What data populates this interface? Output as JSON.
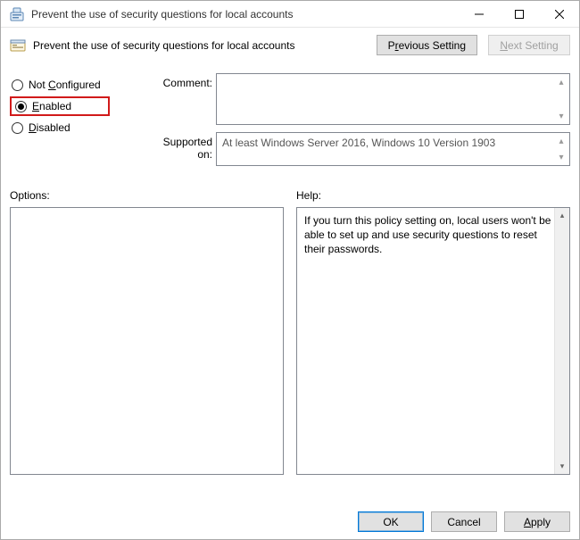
{
  "window": {
    "title": "Prevent the use of security questions for local accounts"
  },
  "header": {
    "policy_title": "Prevent the use of security questions for local accounts",
    "prev_pre": "P",
    "prev_ul": "r",
    "prev_post": "evious Setting",
    "next_ul": "N",
    "next_post": "ext Setting"
  },
  "state": {
    "not_configured_pre": "Not ",
    "not_configured_ul": "C",
    "not_configured_post": "onfigured",
    "enabled_ul": "E",
    "enabled_post": "nabled",
    "disabled_ul": "D",
    "disabled_post": "isabled",
    "selected": "enabled"
  },
  "labels": {
    "comment_pre": "Co",
    "comment_ul": "m",
    "comment_post": "ment:",
    "supported": "Supported on:",
    "options": "Options:",
    "help": "Help:"
  },
  "comment": "",
  "supported_on": "At least Windows Server 2016, Windows 10 Version 1903",
  "help_text": "If you turn this policy setting on, local users won't be able to set up and use security questions to reset their passwords.",
  "buttons": {
    "ok": "OK",
    "cancel": "Cancel",
    "apply_ul": "A",
    "apply_post": "pply"
  }
}
